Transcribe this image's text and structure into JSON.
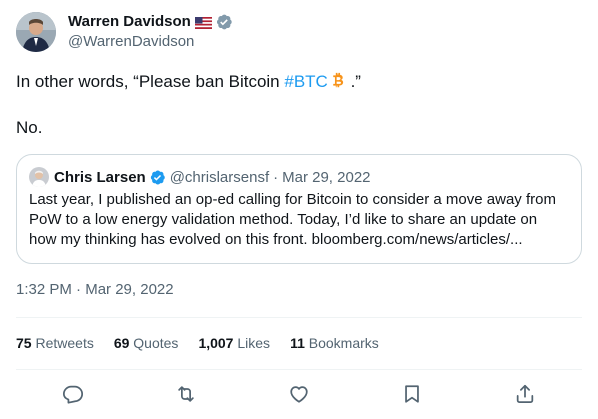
{
  "author": {
    "display_name": "Warren Davidson",
    "flag": "US flag emoji",
    "handle": "@WarrenDavidson",
    "verified_color": "#829aab"
  },
  "tweet": {
    "line1_prefix": "In other words, “Please ban Bitcoin ",
    "hashtag": "#BTC",
    "line1_suffix": " .”",
    "line2": "No."
  },
  "quote": {
    "name": "Chris Larsen",
    "handle": "@chrislarsensf",
    "dot": "·",
    "date": "Mar 29, 2022",
    "lines": [
      "Last year, I published an op-ed calling for Bitcoin to consider a move away from",
      "PoW to a low energy validation method. Today, I’d like to share an update on",
      "how my thinking has evolved on this front. bloomberg.com/news/articles/..."
    ]
  },
  "timestamp": {
    "time": "1:32 PM",
    "separator": " · ",
    "date": "Mar 29, 2022"
  },
  "stats": [
    {
      "count": "75",
      "label": "Retweets"
    },
    {
      "count": "69",
      "label": "Quotes"
    },
    {
      "count": "1,007",
      "label": "Likes"
    },
    {
      "count": "11",
      "label": "Bookmarks"
    }
  ],
  "actions": [
    "reply-icon",
    "retweet-icon",
    "like-icon",
    "bookmark-icon",
    "share-icon"
  ],
  "colors": {
    "link": "#1d9bf0",
    "text": "#0f1419",
    "secondary": "#536471",
    "border": "#cfd9de",
    "bitcoin": "#f7931a"
  }
}
